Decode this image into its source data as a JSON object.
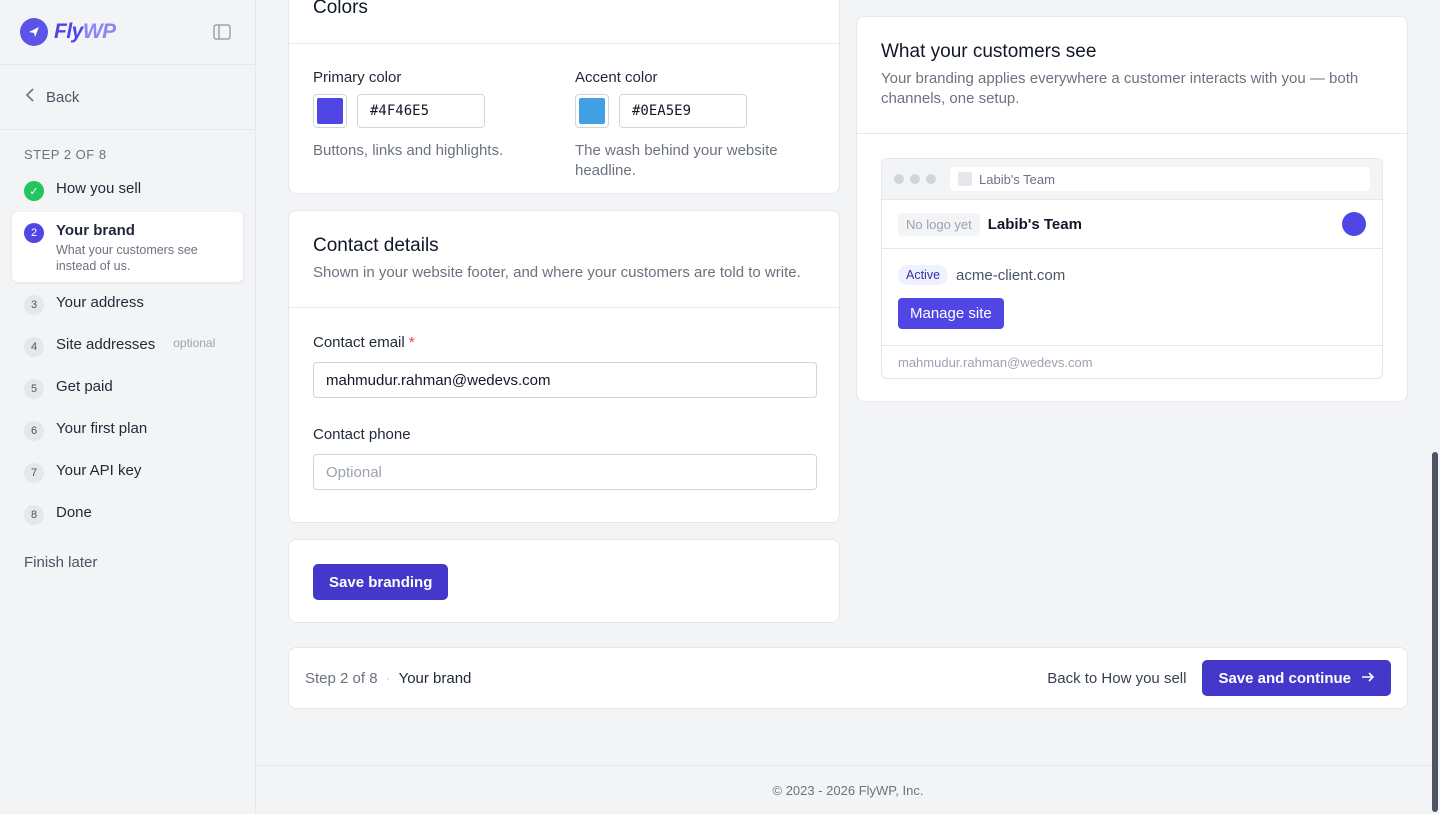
{
  "brand": {
    "logo_main": "Fly",
    "logo_accent": "WP",
    "primary": "#4f46e5"
  },
  "sidebar": {
    "back_label": "Back",
    "progress": "STEP 2 OF 8",
    "steps": [
      {
        "num": "✓",
        "label": "How you sell",
        "state": "done"
      },
      {
        "num": "2",
        "label": "Your brand",
        "sub": "What your customers see instead of us.",
        "state": "active"
      },
      {
        "num": "3",
        "label": "Your address"
      },
      {
        "num": "4",
        "label": "Site addresses",
        "optional": "optional"
      },
      {
        "num": "5",
        "label": "Get paid"
      },
      {
        "num": "6",
        "label": "Your first plan"
      },
      {
        "num": "7",
        "label": "Your API key"
      },
      {
        "num": "8",
        "label": "Done"
      }
    ],
    "finish_later": "Finish later"
  },
  "colors": {
    "title": "Colors",
    "primary_label": "Primary color",
    "primary_value": "#4F46E5",
    "primary_hint": "Buttons, links and highlights.",
    "accent_label": "Accent color",
    "accent_value": "#0EA5E9",
    "accent_hint": "The wash behind your website headline."
  },
  "contact": {
    "title": "Contact details",
    "description": "Shown in your website footer, and where your customers are told to write.",
    "email_label": "Contact email",
    "email_required": "*",
    "email_value": "mahmudur.rahman@wedevs.com",
    "phone_label": "Contact phone",
    "phone_placeholder": "Optional"
  },
  "save": {
    "label": "Save branding"
  },
  "preview": {
    "title": "What your customers see",
    "description": "Your branding applies everywhere a customer interacts with you — both channels, one setup.",
    "tab_title": "Labib's Team",
    "no_logo": "No logo yet",
    "team_name": "Labib's Team",
    "status": "Active",
    "domain": "acme-client.com",
    "manage_label": "Manage site",
    "footer_email": "mahmudur.rahman@wedevs.com"
  },
  "footer_bar": {
    "step_text": "Step 2 of 8",
    "separator": "·",
    "current": "Your brand",
    "back_label": "Back to How you sell",
    "continue_label": "Save and continue"
  },
  "copyright": "© 2023 - 2026 FlyWP, Inc."
}
